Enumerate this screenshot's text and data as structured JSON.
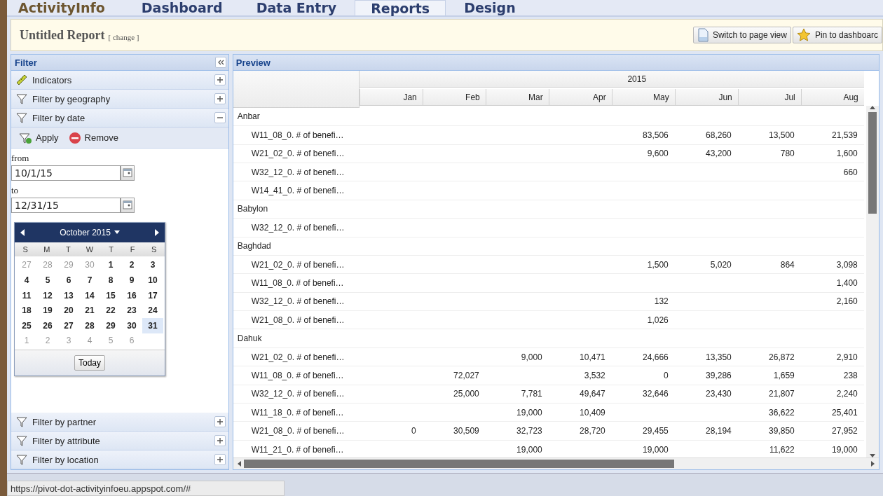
{
  "nav": {
    "logo": "ActivityInfo",
    "tabs": [
      {
        "label": "Dashboard",
        "selected": false
      },
      {
        "label": "Data Entry",
        "selected": false
      },
      {
        "label": "Reports",
        "selected": true
      },
      {
        "label": "Design",
        "selected": false
      }
    ]
  },
  "report": {
    "title": "Untitled Report",
    "change": "[ change ]",
    "buttons": [
      {
        "label": "Switch to page view",
        "kind": "page"
      },
      {
        "label": "Pin to dashboarc",
        "kind": "star"
      }
    ]
  },
  "filter": {
    "title": "Filter",
    "sections_top": [
      {
        "label": "Indicators",
        "kind": "ruler",
        "expanded": false
      },
      {
        "label": "Filter by geography",
        "kind": "funnel",
        "expanded": false
      },
      {
        "label": "Filter by date",
        "kind": "funnel",
        "expanded": true
      }
    ],
    "date": {
      "actions": [
        {
          "label": "Apply",
          "kind": "apply"
        },
        {
          "label": "Remove",
          "kind": "remove"
        }
      ],
      "from_label": "from",
      "from_value": "10/1/15",
      "to_label": "to",
      "to_value": "12/31/15",
      "calendar": {
        "month": "October 2015",
        "weekdays": [
          "S",
          "M",
          "T",
          "W",
          "T",
          "F",
          "S"
        ],
        "today": "Today",
        "days": [
          {
            "label": "27",
            "outside": true,
            "hovered": false
          },
          {
            "label": "28",
            "outside": true,
            "hovered": false
          },
          {
            "label": "29",
            "outside": true,
            "hovered": false
          },
          {
            "label": "30",
            "outside": true,
            "hovered": false
          },
          {
            "label": "1",
            "outside": false,
            "hovered": false
          },
          {
            "label": "2",
            "outside": false,
            "hovered": false
          },
          {
            "label": "3",
            "outside": false,
            "hovered": false
          },
          {
            "label": "4",
            "outside": false,
            "hovered": false
          },
          {
            "label": "5",
            "outside": false,
            "hovered": false
          },
          {
            "label": "6",
            "outside": false,
            "hovered": false
          },
          {
            "label": "7",
            "outside": false,
            "hovered": false
          },
          {
            "label": "8",
            "outside": false,
            "hovered": false
          },
          {
            "label": "9",
            "outside": false,
            "hovered": false
          },
          {
            "label": "10",
            "outside": false,
            "hovered": false
          },
          {
            "label": "11",
            "outside": false,
            "hovered": false
          },
          {
            "label": "12",
            "outside": false,
            "hovered": false
          },
          {
            "label": "13",
            "outside": false,
            "hovered": false
          },
          {
            "label": "14",
            "outside": false,
            "hovered": false
          },
          {
            "label": "15",
            "outside": false,
            "hovered": false
          },
          {
            "label": "16",
            "outside": false,
            "hovered": false
          },
          {
            "label": "17",
            "outside": false,
            "hovered": false
          },
          {
            "label": "18",
            "outside": false,
            "hovered": false
          },
          {
            "label": "19",
            "outside": false,
            "hovered": false
          },
          {
            "label": "20",
            "outside": false,
            "hovered": false
          },
          {
            "label": "21",
            "outside": false,
            "hovered": false
          },
          {
            "label": "22",
            "outside": false,
            "hovered": false
          },
          {
            "label": "23",
            "outside": false,
            "hovered": false
          },
          {
            "label": "24",
            "outside": false,
            "hovered": false
          },
          {
            "label": "25",
            "outside": false,
            "hovered": false
          },
          {
            "label": "26",
            "outside": false,
            "hovered": false
          },
          {
            "label": "27",
            "outside": false,
            "hovered": false
          },
          {
            "label": "28",
            "outside": false,
            "hovered": false
          },
          {
            "label": "29",
            "outside": false,
            "hovered": false
          },
          {
            "label": "30",
            "outside": false,
            "hovered": false
          },
          {
            "label": "31",
            "outside": false,
            "hovered": true
          },
          {
            "label": "1",
            "outside": true,
            "hovered": false
          },
          {
            "label": "2",
            "outside": true,
            "hovered": false
          },
          {
            "label": "3",
            "outside": true,
            "hovered": false
          },
          {
            "label": "4",
            "outside": true,
            "hovered": false
          },
          {
            "label": "5",
            "outside": true,
            "hovered": false
          },
          {
            "label": "6",
            "outside": true,
            "hovered": false
          }
        ]
      }
    },
    "sections_bottom": [
      {
        "label": "Filter by partner",
        "kind": "funnel",
        "expanded": false
      },
      {
        "label": "Filter by attribute",
        "kind": "funnel",
        "expanded": false
      },
      {
        "label": "Filter by location",
        "kind": "funnel",
        "expanded": false
      }
    ]
  },
  "preview": {
    "title": "Preview",
    "year": "2015",
    "months": [
      "Jan",
      "Feb",
      "Mar",
      "Apr",
      "May",
      "Jun",
      "Jul",
      "Aug"
    ],
    "rows": [
      {
        "kind": "group",
        "label": "Anbar"
      },
      {
        "kind": "indicator",
        "label": "W11_08_0. # of benefi…",
        "cells": {
          "may": "83,506",
          "jun": "68,260",
          "jul": "13,500",
          "aug": "21,539"
        }
      },
      {
        "kind": "indicator",
        "label": "W21_02_0. # of benefi…",
        "cells": {
          "may": "9,600",
          "jun": "43,200",
          "jul": "780",
          "aug": "1,600"
        }
      },
      {
        "kind": "indicator",
        "label": "W32_12_0. # of benefi…",
        "cells": {
          "aug": "660"
        }
      },
      {
        "kind": "indicator",
        "label": "W14_41_0. # of benefi…"
      },
      {
        "kind": "group",
        "label": "Babylon"
      },
      {
        "kind": "indicator",
        "label": "W32_12_0. # of benefi…"
      },
      {
        "kind": "group",
        "label": "Baghdad"
      },
      {
        "kind": "indicator",
        "label": "W21_02_0. # of benefi…",
        "cells": {
          "may": "1,500",
          "jun": "5,020",
          "jul": "864",
          "aug": "3,098"
        }
      },
      {
        "kind": "indicator",
        "label": "W11_08_0. # of benefi…",
        "cells": {
          "aug": "1,400"
        }
      },
      {
        "kind": "indicator",
        "label": "W32_12_0. # of benefi…",
        "cells": {
          "may": "132",
          "aug": "2,160"
        }
      },
      {
        "kind": "indicator",
        "label": "W21_08_0. # of benefi…",
        "cells": {
          "may": "1,026"
        }
      },
      {
        "kind": "group",
        "label": "Dahuk"
      },
      {
        "kind": "indicator",
        "label": "W21_02_0. # of benefi…",
        "cells": {
          "mar": "9,000",
          "apr": "10,471",
          "may": "24,666",
          "jun": "13,350",
          "jul": "26,872",
          "aug": "2,910"
        }
      },
      {
        "kind": "indicator",
        "label": "W11_08_0. # of benefi…",
        "cells": {
          "feb": "72,027",
          "apr": "3,532",
          "may": "0",
          "jun": "39,286",
          "jul": "1,659",
          "aug": "238"
        }
      },
      {
        "kind": "indicator",
        "label": "W32_12_0. # of benefi…",
        "cells": {
          "feb": "25,000",
          "mar": "7,781",
          "apr": "49,647",
          "may": "32,646",
          "jun": "23,430",
          "jul": "21,807",
          "aug": "2,240"
        }
      },
      {
        "kind": "indicator",
        "label": "W11_18_0. # of benefi…",
        "cells": {
          "mar": "19,000",
          "apr": "10,409",
          "jul": "36,622",
          "aug": "25,401"
        }
      },
      {
        "kind": "indicator",
        "label": "W21_08_0. # of benefi…",
        "cells": {
          "jan": "0",
          "feb": "30,509",
          "mar": "32,723",
          "apr": "28,720",
          "may": "29,455",
          "jun": "28,194",
          "jul": "39,850",
          "aug": "27,952"
        }
      },
      {
        "kind": "indicator",
        "label": "W11_21_0. # of benefi…",
        "cells": {
          "mar": "19,000",
          "may": "19,000",
          "jul": "11,622",
          "aug": "19,000"
        }
      }
    ]
  },
  "status_url": "https://pivot-dot-activityinfoeu.appspot.com/#"
}
